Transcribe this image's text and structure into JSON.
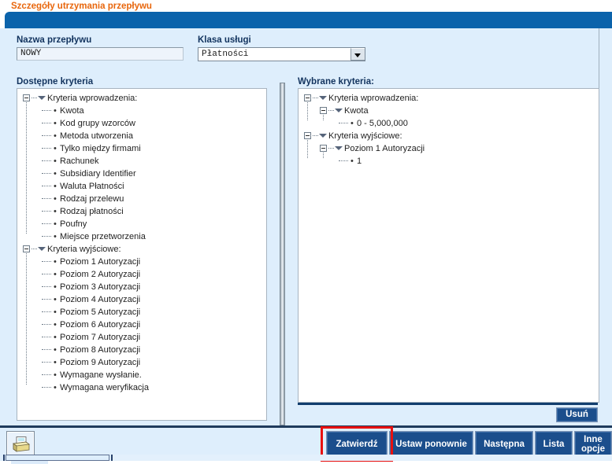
{
  "page": {
    "title": "Szczegóły utrzymania przepływu",
    "title_color": "#E8660C",
    "header_band_color": "#0B63AB",
    "panel_bg_color": "#DEEEFC",
    "button_color": "#1B4E8C",
    "annotation_color": "#E8100F"
  },
  "form": {
    "flow_name": {
      "label": "Nazwa przepływu",
      "value": "NOWY",
      "placeholder": ""
    },
    "service_class": {
      "label": "Klasa usługi",
      "value": "Płatności",
      "options": [
        "Płatności"
      ]
    }
  },
  "available": {
    "heading": "Dostępne kryteria",
    "nodes": [
      {
        "level": 0,
        "type": "group",
        "label": "Kryteria wprowadzenia:"
      },
      {
        "level": 1,
        "type": "leaf",
        "label": "Kwota"
      },
      {
        "level": 1,
        "type": "leaf",
        "label": "Kod grupy wzorców"
      },
      {
        "level": 1,
        "type": "leaf",
        "label": "Metoda utworzenia"
      },
      {
        "level": 1,
        "type": "leaf",
        "label": "Tylko między firmami"
      },
      {
        "level": 1,
        "type": "leaf",
        "label": "Rachunek"
      },
      {
        "level": 1,
        "type": "leaf",
        "label": "Subsidiary Identifier"
      },
      {
        "level": 1,
        "type": "leaf",
        "label": "Waluta Płatności"
      },
      {
        "level": 1,
        "type": "leaf",
        "label": "Rodzaj przelewu"
      },
      {
        "level": 1,
        "type": "leaf",
        "label": "Rodzaj płatności"
      },
      {
        "level": 1,
        "type": "leaf",
        "label": "Poufny"
      },
      {
        "level": 1,
        "type": "leaf",
        "label": "Miejsce przetworzenia"
      },
      {
        "level": 0,
        "type": "group",
        "label": "Kryteria wyjściowe:"
      },
      {
        "level": 1,
        "type": "leaf",
        "label": "Poziom 1 Autoryzacji"
      },
      {
        "level": 1,
        "type": "leaf",
        "label": "Poziom 2 Autoryzacji"
      },
      {
        "level": 1,
        "type": "leaf",
        "label": "Poziom 3 Autoryzacji"
      },
      {
        "level": 1,
        "type": "leaf",
        "label": "Poziom 4 Autoryzacji"
      },
      {
        "level": 1,
        "type": "leaf",
        "label": "Poziom 5 Autoryzacji"
      },
      {
        "level": 1,
        "type": "leaf",
        "label": "Poziom 6 Autoryzacji"
      },
      {
        "level": 1,
        "type": "leaf",
        "label": "Poziom 7 Autoryzacji"
      },
      {
        "level": 1,
        "type": "leaf",
        "label": "Poziom 8 Autoryzacji"
      },
      {
        "level": 1,
        "type": "leaf",
        "label": "Poziom 9 Autoryzacji"
      },
      {
        "level": 1,
        "type": "leaf",
        "label": "Wymagane wysłanie."
      },
      {
        "level": 1,
        "type": "leaf",
        "label": "Wymagana weryfikacja"
      }
    ]
  },
  "selected": {
    "heading": "Wybrane kryteria:",
    "nodes": [
      {
        "level": 0,
        "type": "group",
        "label": "Kryteria wprowadzenia:"
      },
      {
        "level": 1,
        "type": "group",
        "label": "Kwota"
      },
      {
        "level": 2,
        "type": "leaf",
        "label": "0 - 5,000,000"
      },
      {
        "level": 0,
        "type": "group",
        "label": "Kryteria wyjściowe:"
      },
      {
        "level": 1,
        "type": "group",
        "label": "Poziom 1 Autoryzacji"
      },
      {
        "level": 2,
        "type": "leaf",
        "label": "1"
      }
    ],
    "remove_button": "Usuń"
  },
  "toolbar": {
    "print_icon": "printer-icon",
    "buttons": [
      {
        "id": "confirm",
        "label": "Zatwierdź",
        "highlighted": true
      },
      {
        "id": "reset",
        "label": "Ustaw ponownie",
        "highlighted": false
      },
      {
        "id": "next",
        "label": "Następna",
        "highlighted": false
      },
      {
        "id": "list",
        "label": "Lista",
        "highlighted": false
      },
      {
        "id": "other",
        "label": "Inne opcje",
        "highlighted": false
      }
    ]
  }
}
